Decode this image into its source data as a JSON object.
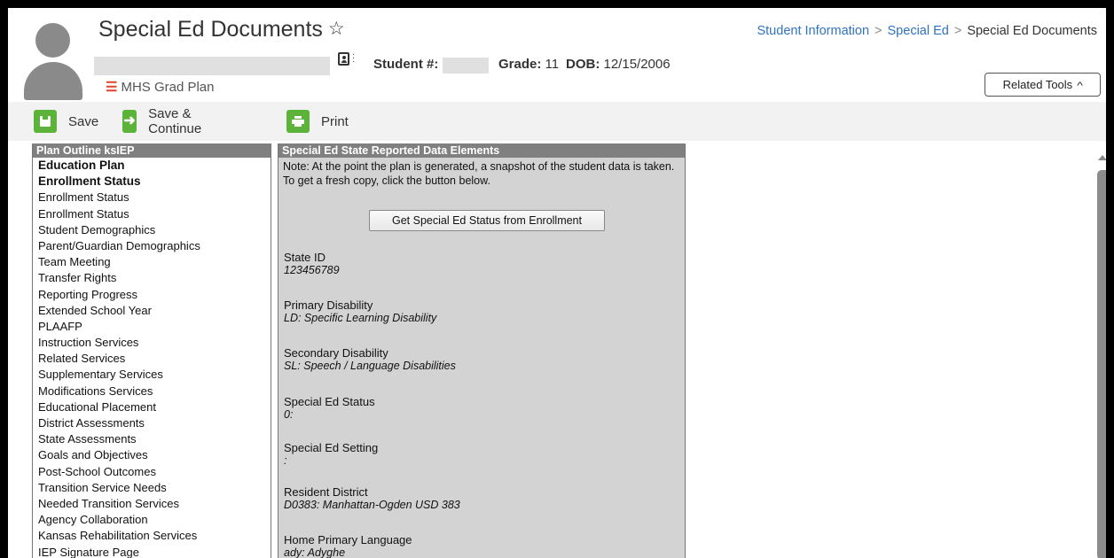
{
  "header": {
    "title": "Special Ed Documents",
    "star_icon": "star-outline-icon",
    "student_label": "Student #:",
    "grade_label": "Grade:",
    "grade_value": "11",
    "dob_label": "DOB:",
    "dob_value": "12/15/2006",
    "grad_plan": "MHS Grad Plan"
  },
  "breadcrumb": {
    "items": [
      "Student Information",
      "Special Ed",
      "Special Ed Documents"
    ],
    "separator": ">"
  },
  "related_tools": {
    "label": "Related Tools"
  },
  "toolbar": {
    "save_label": "Save",
    "save_continue_label": "Save & Continue",
    "print_label": "Print",
    "accent_color": "#5cb33a"
  },
  "outline": {
    "title": "Plan Outline ksIEP",
    "items": [
      "Education Plan",
      "Enrollment Status",
      "Enrollment Status",
      "Enrollment Status",
      "Student Demographics",
      "Parent/Guardian Demographics",
      "Team Meeting",
      "Transfer Rights",
      "Reporting Progress",
      "Extended School Year",
      "PLAAFP",
      "Instruction Services",
      "Related Services",
      "Supplementary Services",
      "Modifications Services",
      "Educational Placement",
      "District Assessments",
      "State Assessments",
      "Goals and Objectives",
      "Post-School Outcomes",
      "Transition Service Needs",
      "Needed Transition Services",
      "Agency Collaboration",
      "Kansas Rehabilitation Services",
      "IEP Signature Page"
    ]
  },
  "data_panel": {
    "title": "Special Ed State Reported Data Elements",
    "note": "Note: At the point the plan is generated, a snapshot of the student data is taken. To get a fresh copy, click the button below.",
    "button_label": "Get Special Ed Status from Enrollment",
    "fields": [
      {
        "label": "State ID",
        "value": "123456789"
      },
      {
        "label": "Primary Disability",
        "value": "LD: Specific Learning Disability"
      },
      {
        "label": "Secondary Disability",
        "value": "SL: Speech / Language Disabilities"
      },
      {
        "label": "Special Ed Status",
        "value": "0:"
      },
      {
        "label": "Special Ed Setting",
        "value": ":"
      },
      {
        "label": "Resident District",
        "value": "D0383: Manhattan-Ogden USD 383"
      },
      {
        "label": "Home Primary Language",
        "value": "ady: Adyghe"
      }
    ]
  }
}
